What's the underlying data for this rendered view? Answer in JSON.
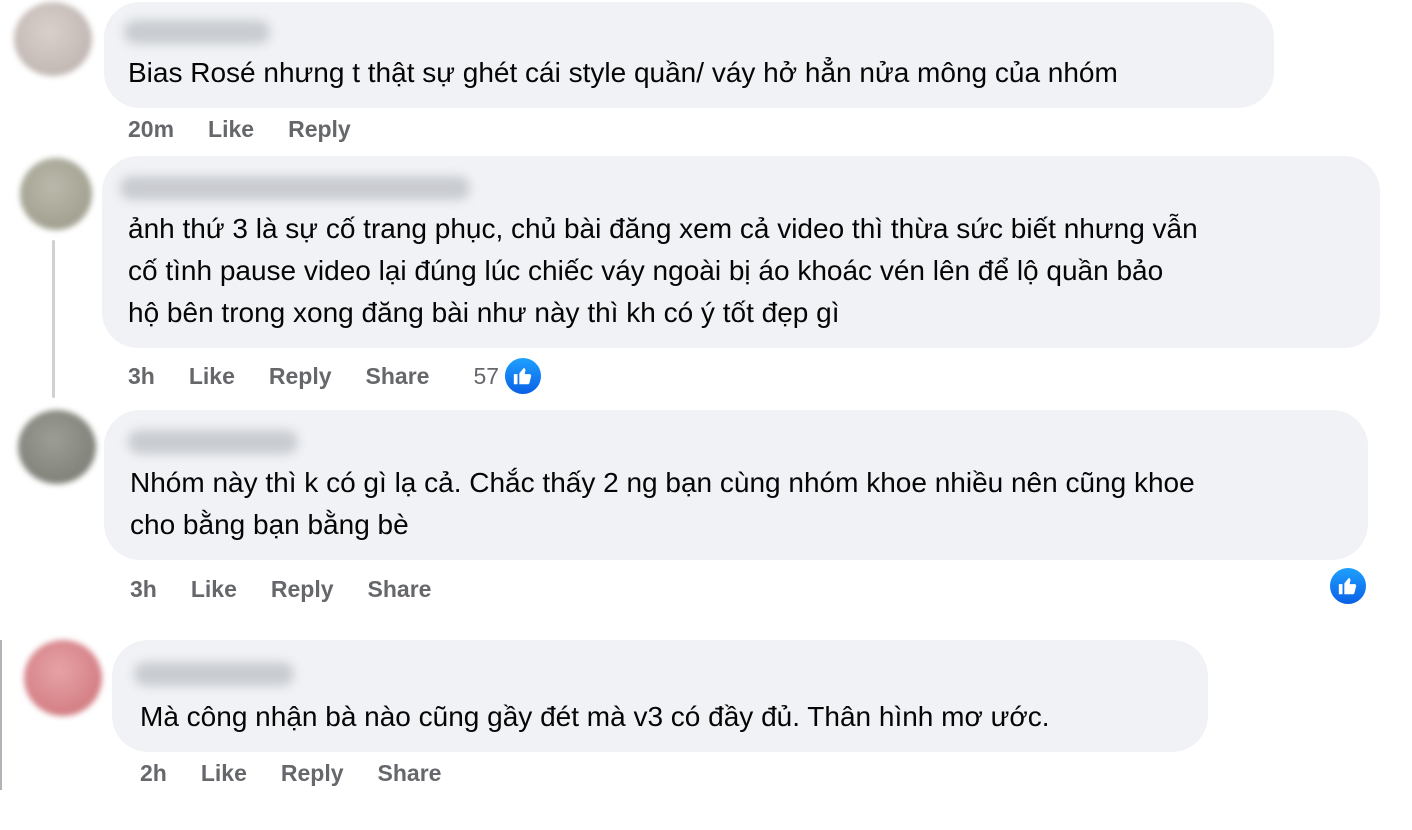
{
  "comments": [
    {
      "text_lines": [
        "Bias Rosé nhưng t thật sự ghét cái style quần/ váy hở hẳn nửa mông của nhóm"
      ],
      "time": "20m",
      "like_label": "Like",
      "reply_label": "Reply",
      "avatar_color": "#c8bfbb"
    },
    {
      "text_lines": [
        "ảnh thứ 3 là sự cố trang phục, chủ bài đăng xem cả video thì thừa sức biết nhưng vẫn",
        "cố tình pause video lại đúng lúc chiếc váy ngoài bị áo khoác vén lên để lộ quần bảo",
        "hộ bên trong xong đăng bài như này thì kh có ý tốt đẹp gì"
      ],
      "time": "3h",
      "like_label": "Like",
      "reply_label": "Reply",
      "share_label": "Share",
      "reaction_count": "57",
      "avatar_color": "#a9a89a"
    },
    {
      "text_lines": [
        "Nhóm này thì k có gì lạ cả. Chắc thấy 2 ng bạn cùng nhóm khoe nhiều nên cũng khoe",
        "cho bằng bạn bằng bè"
      ],
      "time": "3h",
      "like_label": "Like",
      "reply_label": "Reply",
      "share_label": "Share",
      "avatar_color": "#8d8f86"
    },
    {
      "text_lines": [
        "Mà công nhận bà nào cũng gầy đét mà v3 có đầy đủ. Thân hình mơ ước."
      ],
      "time": "2h",
      "like_label": "Like",
      "reply_label": "Reply",
      "share_label": "Share",
      "avatar_color": "#d98a8f"
    }
  ],
  "reaction_icon": "thumbs-up-icon",
  "colors": {
    "bubble": "#f0f2f5",
    "action_text": "#65676b",
    "like_blue": "#1877f2"
  }
}
